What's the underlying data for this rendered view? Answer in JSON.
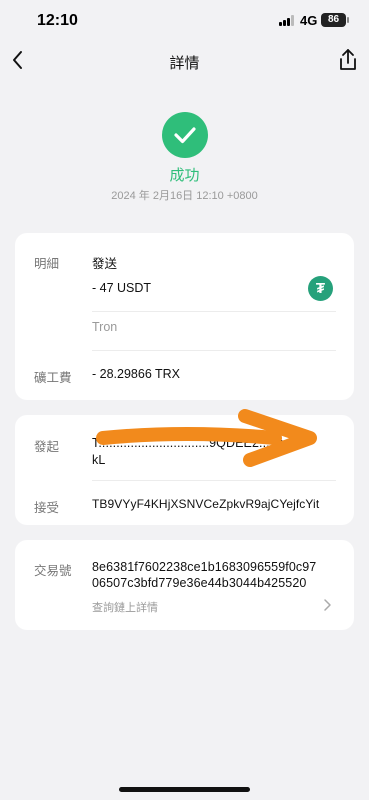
{
  "status_bar": {
    "time": "12:10",
    "network": "4G",
    "battery": "86"
  },
  "nav": {
    "title": "詳情"
  },
  "header": {
    "status": "成功",
    "datetime": "2024 年 2月16日 12:10 +0800"
  },
  "details": {
    "label": "明細",
    "type": "發送",
    "amount": "- 47 USDT",
    "token_symbol": "₮",
    "network": "Tron",
    "fee_label": "礦工費",
    "fee": "- 28.29866 TRX"
  },
  "parties": {
    "from_label": "發起",
    "from_line1": "T...............................9QDEE2...9ze14",
    "from_line2": "kL",
    "to_label": "接受",
    "to_address": "TB9VYyF4KHjXSNVCeZpkvR9ajCYejfcYit"
  },
  "tx": {
    "label": "交易號",
    "hash_line1": "8e6381f7602238ce1b1683096559f0c97",
    "hash_line2": "06507c3bfd779e36e44b3044b425520",
    "explorer_link": "查詢鏈上詳情"
  },
  "colors": {
    "success": "#2fbe7a",
    "tether": "#26a17b",
    "annotation_arrow": "#f28a1c"
  }
}
